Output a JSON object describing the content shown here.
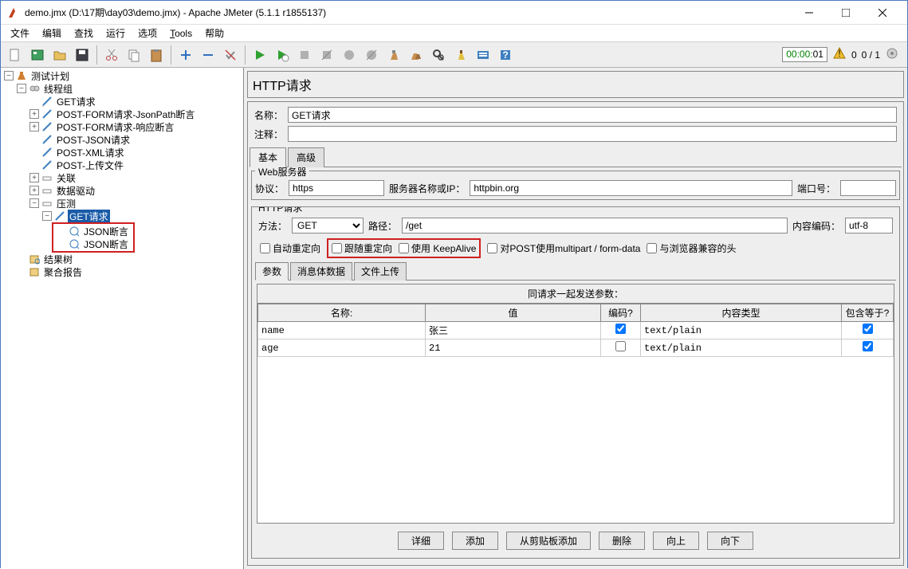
{
  "window": {
    "title": "demo.jmx (D:\\17期\\day03\\demo.jmx) - Apache JMeter (5.1.1 r1855137)"
  },
  "menu": {
    "file": "文件",
    "edit": "编辑",
    "search": "查找",
    "run": "运行",
    "options": "选项",
    "tools": "Tools",
    "help": "帮助"
  },
  "toolbar_status": {
    "timer": "00:00:01",
    "count": "0 / 1"
  },
  "tree": {
    "testplan": "测试计划",
    "threadgroup": "线程组",
    "items": {
      "get": "GET请求",
      "post_form_json": "POST-FORM请求-JsonPath断言",
      "post_form_resp": "POST-FORM请求-响应断言",
      "post_json": "POST-JSON请求",
      "post_xml": "POST-XML请求",
      "post_upload": "POST-上传文件",
      "relation": "关联",
      "datadriven": "数据驱动",
      "pressure": "压测",
      "pressure_get": "GET请求",
      "json_assert1": "JSON断言",
      "json_assert2": "JSON断言",
      "result_tree": "结果树",
      "agg_report": "聚合报告"
    }
  },
  "main": {
    "title": "HTTP请求",
    "name_label": "名称：",
    "name_value": "GET请求",
    "comment_label": "注释：",
    "comment_value": "",
    "tab_basic": "基本",
    "tab_advanced": "高级",
    "webserver": {
      "legend": "Web服务器",
      "protocol_label": "协议：",
      "protocol": "https",
      "server_label": "服务器名称或IP：",
      "server": "httpbin.org",
      "port_label": "端口号：",
      "port": ""
    },
    "httpreq": {
      "legend": "HTTP请求",
      "method_label": "方法：",
      "method": "GET",
      "path_label": "路径：",
      "path": "/get",
      "encoding_label": "内容编码：",
      "encoding": "utf-8",
      "auto_redirect": "自动重定向",
      "follow_redirect": "跟随重定向",
      "keepalive": "使用 KeepAlive",
      "multipart": "对POST使用multipart / form-data",
      "browser_compat": "与浏览器兼容的头"
    },
    "subtabs": {
      "params": "参数",
      "body": "消息体数据",
      "files": "文件上传"
    },
    "table": {
      "caption": "同请求一起发送参数：",
      "h_name": "名称:",
      "h_value": "值",
      "h_encode": "编码?",
      "h_type": "内容类型",
      "h_equals": "包含等于?",
      "rows": [
        {
          "name": "name",
          "value": "张三",
          "encode": true,
          "type": "text/plain",
          "equals": true
        },
        {
          "name": "age",
          "value": "21",
          "encode": false,
          "type": "text/plain",
          "equals": true
        }
      ]
    },
    "buttons": {
      "detail": "详细",
      "add": "添加",
      "clipboard": "从剪贴板添加",
      "delete": "删除",
      "up": "向上",
      "down": "向下"
    }
  }
}
